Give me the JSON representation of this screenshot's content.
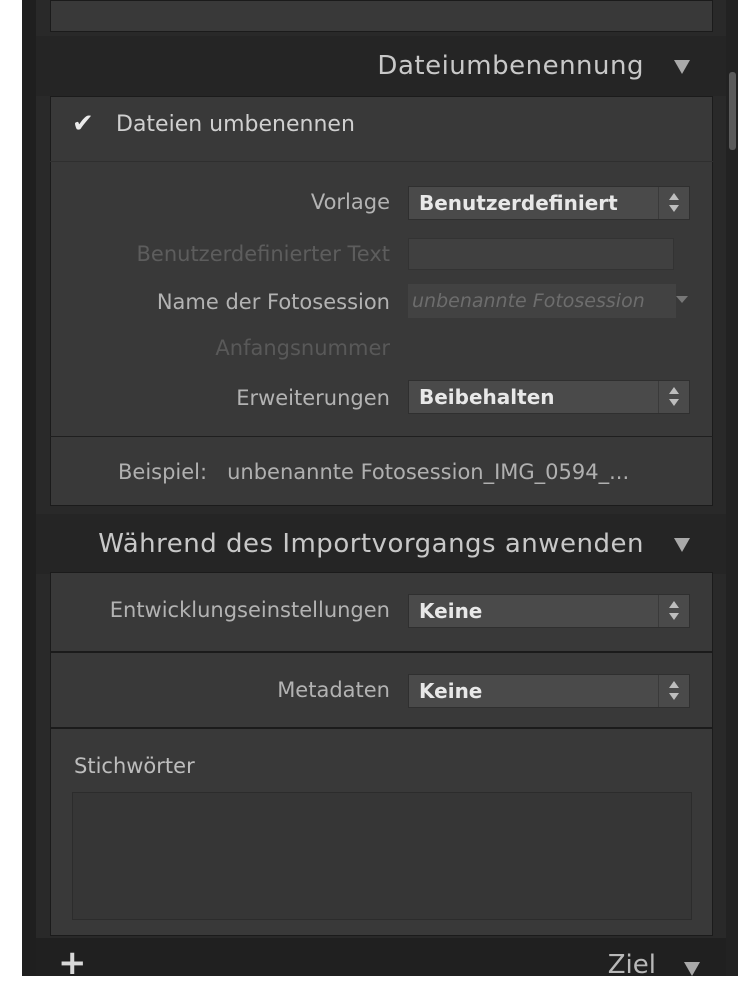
{
  "top_box": {},
  "file_renaming": {
    "header": "Dateiumbenennung",
    "rename_checkbox": {
      "label": "Dateien umbenennen",
      "checked": true
    },
    "template": {
      "label": "Vorlage",
      "value": "Benutzerdefiniert"
    },
    "custom_text": {
      "label": "Benutzerdefinierter Text",
      "value": ""
    },
    "session_name": {
      "label": "Name der Fotosession",
      "placeholder": "unbenannte Fotosession"
    },
    "start_number": {
      "label": "Anfangsnummer"
    },
    "extensions": {
      "label": "Erweiterungen",
      "value": "Beibehalten"
    },
    "example": {
      "label": "Beispiel:",
      "value": "unbenannte Fotosession_IMG_0594_..."
    }
  },
  "apply_during_import": {
    "header": "Während des Importvorgangs anwenden",
    "develop_settings": {
      "label": "Entwicklungseinstellungen",
      "value": "Keine"
    },
    "metadata": {
      "label": "Metadaten",
      "value": "Keine"
    },
    "keywords": {
      "label": "Stichwörter",
      "value": ""
    }
  },
  "destination": {
    "add_icon": "plus-icon",
    "header": "Ziel"
  },
  "colors": {
    "panel": "#292929",
    "box": "#393939",
    "header_bar": "#252525",
    "text": "#c8c8c8"
  }
}
